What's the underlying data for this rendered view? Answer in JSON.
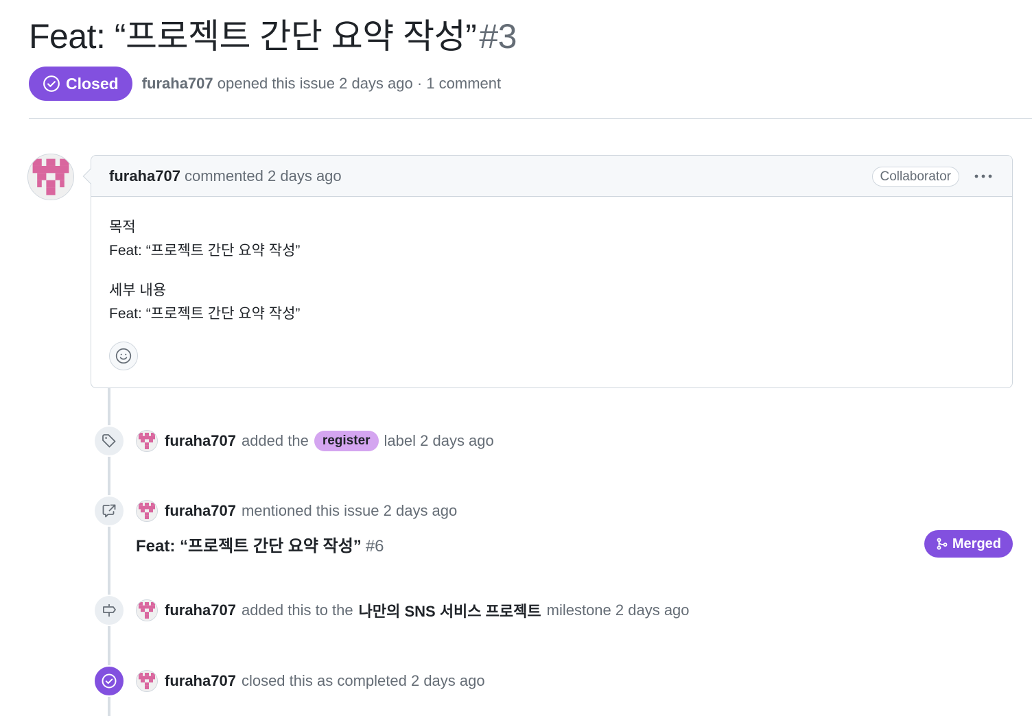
{
  "issue": {
    "title": "Feat: “프로젝트 간단 요약 작성”",
    "number": "#3",
    "state_label": "Closed",
    "author": "furaha707",
    "meta": "opened this issue 2 days ago · 1 comment"
  },
  "comment": {
    "author": "furaha707",
    "action": "commented 2 days ago",
    "role_badge": "Collaborator",
    "body": {
      "heading1": "목적",
      "line1": "Feat: “프로젝트 간단 요약 작성”",
      "heading2": "세부 내용",
      "line2": "Feat: “프로젝트 간단 요약 작성”"
    }
  },
  "events": {
    "label": {
      "author": "furaha707",
      "prefix": "added the",
      "label_name": "register",
      "suffix": "label 2 days ago"
    },
    "mention": {
      "author": "furaha707",
      "text": "mentioned this issue 2 days ago",
      "ref_title": "Feat: “프로젝트 간단 요약 작성”",
      "ref_number": "#6",
      "ref_state": "Merged"
    },
    "milestone": {
      "author": "furaha707",
      "prefix": "added this to the",
      "milestone_name": "나만의 SNS 서비스 프로젝트",
      "suffix": "milestone 2 days ago"
    },
    "closed": {
      "author": "furaha707",
      "text": "closed this as completed 2 days ago"
    }
  },
  "colors": {
    "closed_purple": "#8250df",
    "label_register": "#d4a5f0",
    "avatar_pink": "#d9669e"
  }
}
